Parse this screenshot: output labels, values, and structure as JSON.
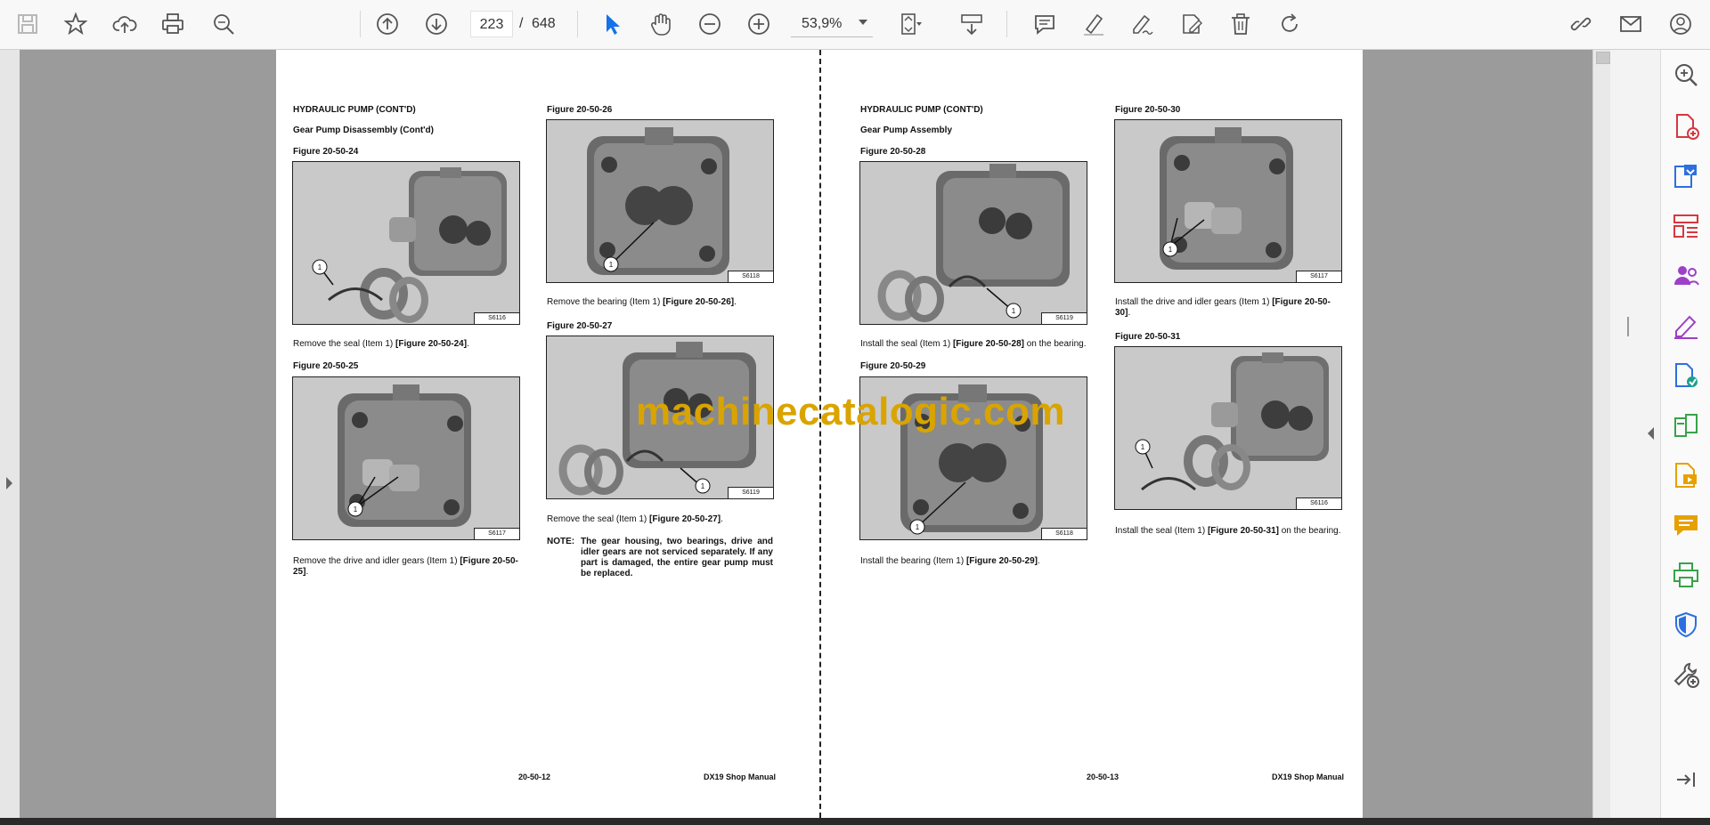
{
  "toolbar": {
    "icons": [
      "save-icon",
      "bookmark-star-icon",
      "upload-cloud-icon",
      "print-icon",
      "find-zoom-icon",
      "previous-page-icon",
      "next-page-icon",
      "select-pointer-icon",
      "pan-hand-icon",
      "zoom-out-icon",
      "zoom-in-icon",
      "page-fit-icon",
      "scroll-mode-icon",
      "comment-icon",
      "highlight-icon",
      "sign-icon",
      "fill-sign-icon",
      "delete-icon",
      "rotate-icon",
      "share-link-icon",
      "email-icon",
      "account-icon"
    ],
    "current_page": "223",
    "page_separator": "/",
    "total_pages": "648",
    "zoom": "53,9%",
    "accent_color": "#1473e6"
  },
  "left_page": {
    "section_title": "HYDRAULIC PUMP (CONT'D)",
    "subsection_title": "Gear Pump Disassembly (Cont'd)",
    "fig24_label": "Figure 20-50-24",
    "fig24_code": "S6116",
    "fig24_caption_pre": "Remove the seal (Item 1) ",
    "fig24_caption_ref": "[Figure 20-50-24]",
    "fig24_caption_post": ".",
    "fig25_label": "Figure 20-50-25",
    "fig25_code": "S6117",
    "fig25_caption_pre": "Remove the drive and idler gears (Item 1) ",
    "fig25_caption_ref": "[Figure 20-50-25]",
    "fig25_caption_post": ".",
    "fig26_label": "Figure 20-50-26",
    "fig26_code": "S6118",
    "fig26_caption_pre": "Remove the bearing (Item 1) ",
    "fig26_caption_ref": "[Figure 20-50-26]",
    "fig26_caption_post": ".",
    "fig27_label": "Figure 20-50-27",
    "fig27_code": "S6119",
    "fig27_caption_pre": "Remove the seal (Item 1) ",
    "fig27_caption_ref": "[Figure 20-50-27]",
    "fig27_caption_post": ".",
    "note_label": "NOTE:",
    "note_text": "The gear housing, two bearings, drive and idler gears are not serviced separately. If any part is damaged, the entire gear pump must be replaced.",
    "page_number": "20-50-12",
    "manual_title": "DX19 Shop Manual"
  },
  "right_page": {
    "section_title": "HYDRAULIC PUMP (CONT'D)",
    "subsection_title": "Gear Pump Assembly",
    "fig28_label": "Figure 20-50-28",
    "fig28_code": "S6119",
    "fig28_caption_pre": "Install the seal (Item 1) ",
    "fig28_caption_ref": "[Figure 20-50-28]",
    "fig28_caption_post": " on the bearing.",
    "fig29_label": "Figure 20-50-29",
    "fig29_code": "S6118",
    "fig29_caption_pre": "Install the bearing (Item 1) ",
    "fig29_caption_ref": "[Figure 20-50-29]",
    "fig29_caption_post": ".",
    "fig30_label": "Figure 20-50-30",
    "fig30_code": "S6117",
    "fig30_caption_pre": "Install the drive and idler gears (Item 1) ",
    "fig30_caption_ref": "[Figure 20-50-30]",
    "fig30_caption_post": ".",
    "fig31_label": "Figure 20-50-31",
    "fig31_code": "S6116",
    "fig31_caption_pre": "Install the seal (Item 1) ",
    "fig31_caption_ref": "[Figure 20-50-31]",
    "fig31_caption_post": " on the bearing.",
    "page_number": "20-50-13",
    "manual_title": "DX19 Shop Manual"
  },
  "callout_number": "1",
  "watermark": "machinecatalogic.com",
  "right_panel": {
    "icons": [
      "search-zoom-icon",
      "create-pdf-icon",
      "export-pdf-icon",
      "organize-pages-icon",
      "share-people-icon",
      "edit-pdf-icon",
      "convert-pdf-icon",
      "compare-files-icon",
      "rich-media-icon",
      "comment-bubble-icon",
      "print-production-icon",
      "protect-shield-icon",
      "more-tools-icon",
      "collapse-panel-icon"
    ]
  }
}
